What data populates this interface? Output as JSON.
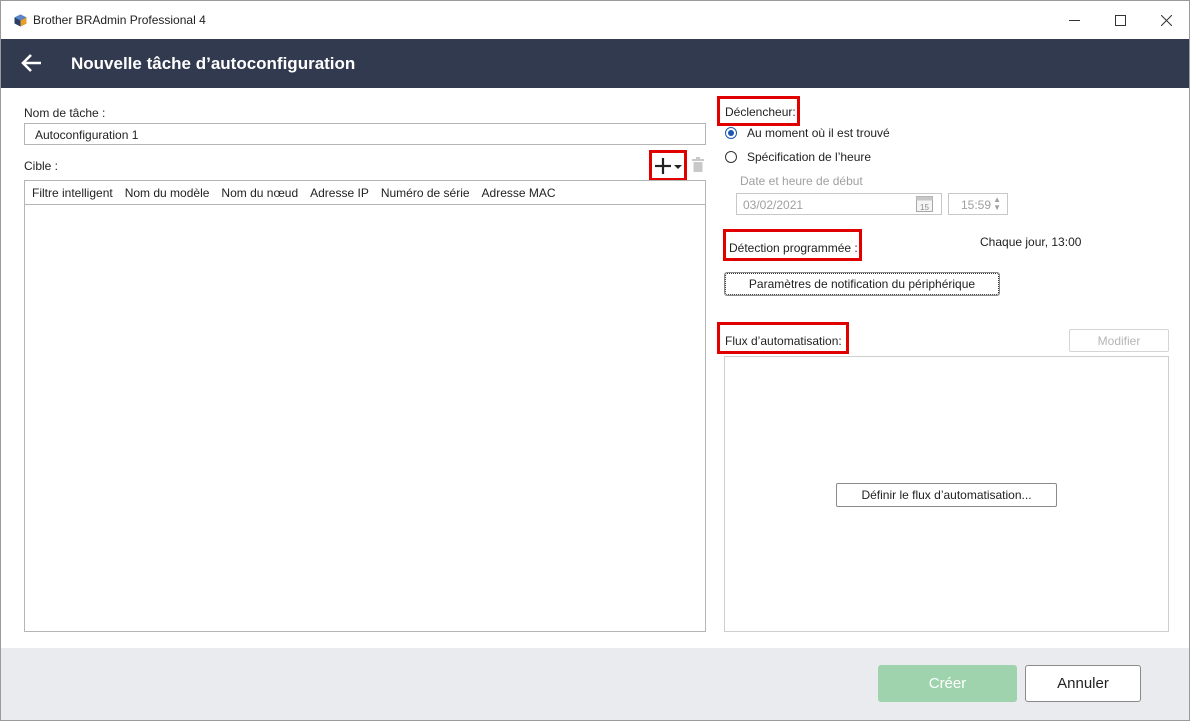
{
  "window": {
    "title": "Brother BRAdmin Professional 4",
    "controls": {
      "minimize": "—",
      "maximize": "☐",
      "close": "✕"
    }
  },
  "header": {
    "title": "Nouvelle tâche d’autoconfiguration",
    "back_icon": "arrow-left-icon"
  },
  "left": {
    "task_name_label": "Nom de tâche :",
    "task_name_value": "Autoconfiguration 1",
    "target_label": "Cible :",
    "add_icon": "plus-dropdown-icon",
    "delete_icon": "trash-icon",
    "columns": [
      "Filtre intelligent",
      "Nom du modèle",
      "Nom du nœud",
      "Adresse IP",
      "Numéro de série",
      "Adresse MAC"
    ],
    "rows": []
  },
  "right": {
    "trigger_label": "Déclencheur:",
    "trigger_options": [
      {
        "label": "Au moment où il est trouvé",
        "checked": true
      },
      {
        "label": "Spécification de l’heure",
        "checked": false
      }
    ],
    "start_label": "Date et heure de début",
    "start_date": "03/02/2021",
    "calendar_day": "15",
    "start_time": "15:59",
    "scheduled_detection_label": "Détection programmée :",
    "scheduled_detection_value": "Chaque jour, 13:00",
    "notification_button": "Paramètres de notification du périphérique",
    "automation_flow_label": "Flux d’automatisation:",
    "modify_button": "Modifier",
    "define_flow_button": "Définir le flux d’automatisation..."
  },
  "footer": {
    "create_button": "Créer",
    "cancel_button": "Annuler"
  },
  "colors": {
    "header_bg": "#323a4f",
    "highlight": "#e00000",
    "create_disabled": "#9ed3ae",
    "footer_bg": "#e9ebee",
    "radio_accent": "#1a56b3"
  }
}
